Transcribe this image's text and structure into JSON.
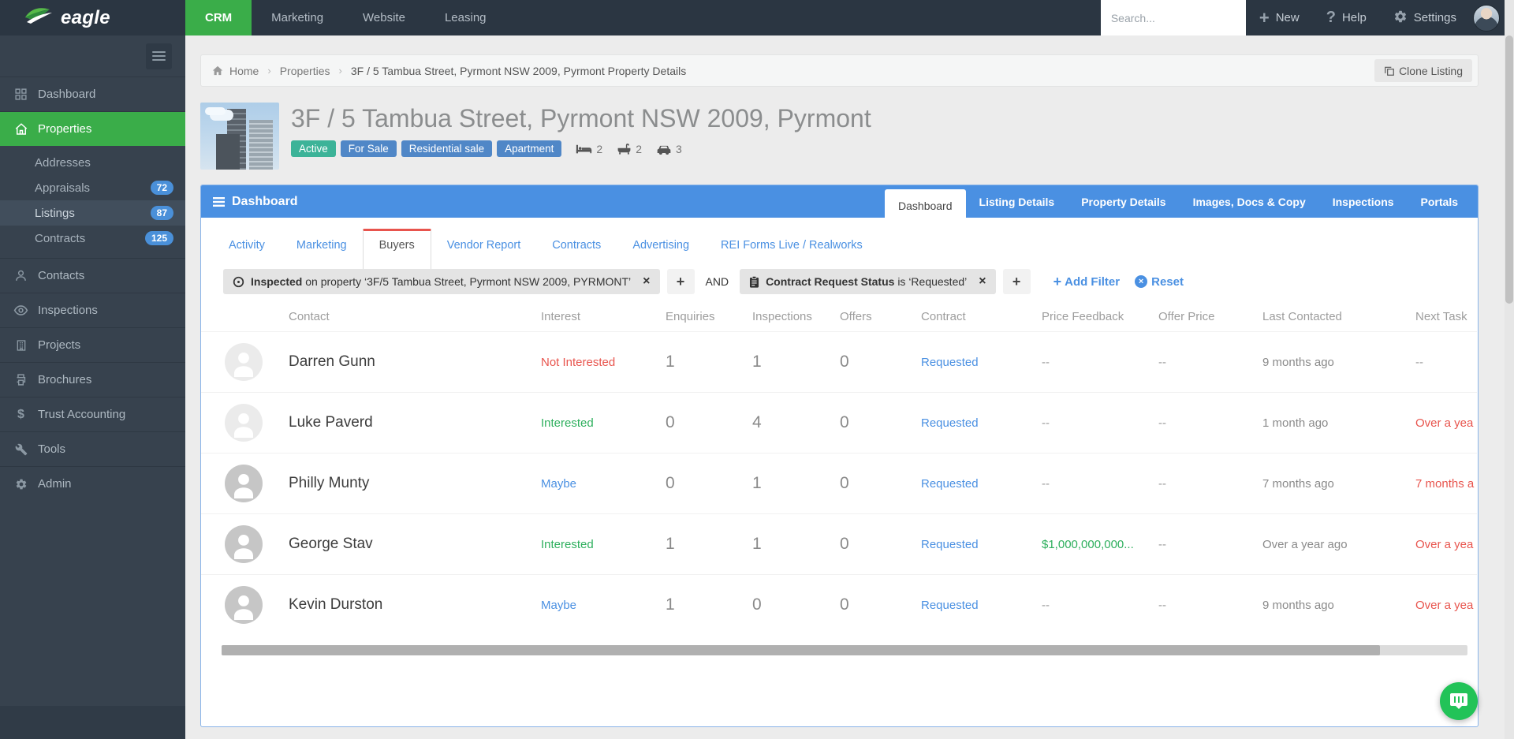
{
  "nav": {
    "brand": "eagle",
    "tabs": [
      "CRM",
      "Marketing",
      "Website",
      "Leasing"
    ],
    "search_placeholder": "Search...",
    "new_label": "New",
    "help_label": "Help",
    "settings_label": "Settings"
  },
  "sidebar": {
    "items": [
      {
        "label": "Dashboard"
      },
      {
        "label": "Properties"
      },
      {
        "label": "Addresses"
      },
      {
        "label": "Appraisals",
        "badge": "72"
      },
      {
        "label": "Listings",
        "badge": "87"
      },
      {
        "label": "Contracts",
        "badge": "125"
      },
      {
        "label": "Contacts"
      },
      {
        "label": "Inspections"
      },
      {
        "label": "Projects"
      },
      {
        "label": "Brochures"
      },
      {
        "label": "Trust Accounting"
      },
      {
        "label": "Tools"
      },
      {
        "label": "Admin"
      }
    ]
  },
  "breadcrumb": {
    "items": [
      "Home",
      "Properties",
      "3F / 5 Tambua Street, Pyrmont NSW 2009, Pyrmont Property Details"
    ],
    "clone_label": "Clone Listing"
  },
  "property": {
    "title": "3F / 5 Tambua Street, Pyrmont NSW 2009, Pyrmont",
    "status_badges": [
      {
        "label": "Active",
        "color": "#3cb398"
      },
      {
        "label": "For Sale",
        "color": "#5087c7"
      },
      {
        "label": "Residential sale",
        "color": "#5087c7"
      },
      {
        "label": "Apartment",
        "color": "#5087c7"
      }
    ],
    "features": [
      {
        "name": "beds",
        "count": "2"
      },
      {
        "name": "baths",
        "count": "2"
      },
      {
        "name": "cars",
        "count": "3"
      }
    ]
  },
  "panel": {
    "title": "Dashboard",
    "tabs": [
      "Dashboard",
      "Listing Details",
      "Property Details",
      "Images, Docs & Copy",
      "Inspections",
      "Portals"
    ],
    "subtabs": [
      "Activity",
      "Marketing",
      "Buyers",
      "Vendor Report",
      "Contracts",
      "Advertising",
      "REI Forms Live / Realworks"
    ],
    "filters": {
      "filter1_field": "Inspected",
      "filter1_text": "on property ‘3F/5 Tambua Street, Pyrmont NSW 2009, PYRMONT’",
      "and_label": "AND",
      "filter2_field": "Contract Request Status",
      "filter2_text": "is ‘Requested’",
      "add_filter_label": "Add Filter",
      "reset_label": "Reset"
    },
    "table": {
      "columns": [
        "Contact",
        "Interest",
        "Enquiries",
        "Inspections",
        "Offers",
        "Contract",
        "Price Feedback",
        "Offer Price",
        "Last Contacted",
        "Next Task"
      ],
      "rows": [
        {
          "name": "Darren Gunn",
          "interest": "Not Interested",
          "interest_color": "#e8544d",
          "enquiries": "1",
          "inspections": "1",
          "offers": "0",
          "contract": "Requested",
          "price_feedback": "--",
          "price_feedback_color": "#999999",
          "offer_price": "--",
          "last_contacted": "9 months ago",
          "next_task": "--",
          "next_task_color": "#999999"
        },
        {
          "name": "Luke Paverd",
          "interest": "Interested",
          "interest_color": "#2eaf5d",
          "enquiries": "0",
          "inspections": "4",
          "offers": "0",
          "contract": "Requested",
          "price_feedback": "--",
          "price_feedback_color": "#999999",
          "offer_price": "--",
          "last_contacted": "1 month ago",
          "next_task": "Over a yea",
          "next_task_color": "#e8544d"
        },
        {
          "name": "Philly Munty",
          "interest": "Maybe",
          "interest_color": "#4a90e2",
          "enquiries": "0",
          "inspections": "1",
          "offers": "0",
          "contract": "Requested",
          "price_feedback": "--",
          "price_feedback_color": "#999999",
          "offer_price": "--",
          "last_contacted": "7 months ago",
          "next_task": "7 months a",
          "next_task_color": "#e8544d"
        },
        {
          "name": "George Stav",
          "interest": "Interested",
          "interest_color": "#2eaf5d",
          "enquiries": "1",
          "inspections": "1",
          "offers": "0",
          "contract": "Requested",
          "price_feedback": "$1,000,000,000...",
          "price_feedback_color": "#2eaf5d",
          "offer_price": "--",
          "last_contacted": "Over a year ago",
          "next_task": "Over a yea",
          "next_task_color": "#e8544d"
        },
        {
          "name": "Kevin Durston",
          "interest": "Maybe",
          "interest_color": "#4a90e2",
          "enquiries": "1",
          "inspections": "0",
          "offers": "0",
          "contract": "Requested",
          "price_feedback": "--",
          "price_feedback_color": "#999999",
          "offer_price": "--",
          "last_contacted": "9 months ago",
          "next_task": "Over a yea",
          "next_task_color": "#e8544d"
        }
      ]
    }
  }
}
